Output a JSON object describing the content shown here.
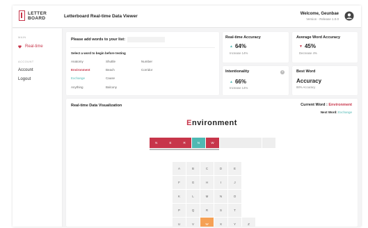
{
  "header": {
    "logo_line1": "LETTER",
    "logo_line2": "BOARD",
    "title": "Letterboard Real-time Data Viewer",
    "welcome": "Welcome, Geunbae",
    "version": "Version - Release 1.0.0"
  },
  "sidebar": {
    "section_main": "MAIN",
    "realtime": "Real-time",
    "section_account": "ACCOUNT",
    "account": "Account",
    "logout": "Logout"
  },
  "words_panel": {
    "title": "Please add words to your list:",
    "input_value": "",
    "subtitle": "Select a word to begin before testing",
    "words": [
      "Anatomy",
      "Shuttle",
      "Number",
      "Environment",
      "Beach",
      "Corridor",
      "Exchange",
      "Cause",
      "Anything",
      "Balcony"
    ]
  },
  "stats": {
    "realtime_accuracy": {
      "title": "Real-time Accuracy",
      "value": "64%",
      "sub": "Increase 14%",
      "arrow": "▲"
    },
    "avg_accuracy": {
      "title": "Average Word Accuracy",
      "value": "45%",
      "sub": "Decrease 4%",
      "arrow": "▼"
    },
    "intentionality": {
      "title": "Intentionality",
      "value": "66%",
      "sub": "Increase 14%",
      "arrow": "▲",
      "help": "?"
    },
    "best_word": {
      "title": "Best Word",
      "value": "Accuracy",
      "sub": "88% Accuracy"
    }
  },
  "visualization": {
    "title": "Real-time Data Visualization",
    "current_label": "Current Word : ",
    "current_word": "Environment",
    "next_label": "Next Word: ",
    "next_word": "Exchange",
    "big_word_first": "E",
    "big_word_rest": "nvironment",
    "slots": [
      {
        "letter": "N",
        "state": "red"
      },
      {
        "letter": "E",
        "state": "red"
      },
      {
        "letter": "R",
        "state": "red"
      },
      {
        "letter": "N",
        "state": "teal"
      },
      {
        "letter": "W",
        "state": "red"
      },
      {
        "letter": "",
        "state": "empty"
      },
      {
        "letter": "",
        "state": "empty"
      },
      {
        "letter": "",
        "state": "empty"
      },
      {
        "letter": "",
        "state": "empty"
      }
    ],
    "keyboard_rows": [
      [
        "A",
        "B",
        "C",
        "D",
        "E",
        ""
      ],
      [
        "F",
        "G",
        "H",
        "I",
        "J",
        ""
      ],
      [
        "K",
        "L",
        "M",
        "N",
        "O",
        ""
      ],
      [
        "P",
        "Q",
        "R",
        "S",
        "T",
        ""
      ],
      [
        "U",
        "V",
        "W",
        "X",
        "Y",
        "Z"
      ]
    ],
    "highlighted_key": "W"
  },
  "colors": {
    "accent": "#c7354a",
    "teal": "#4fb8b3",
    "orange": "#f5a155"
  }
}
